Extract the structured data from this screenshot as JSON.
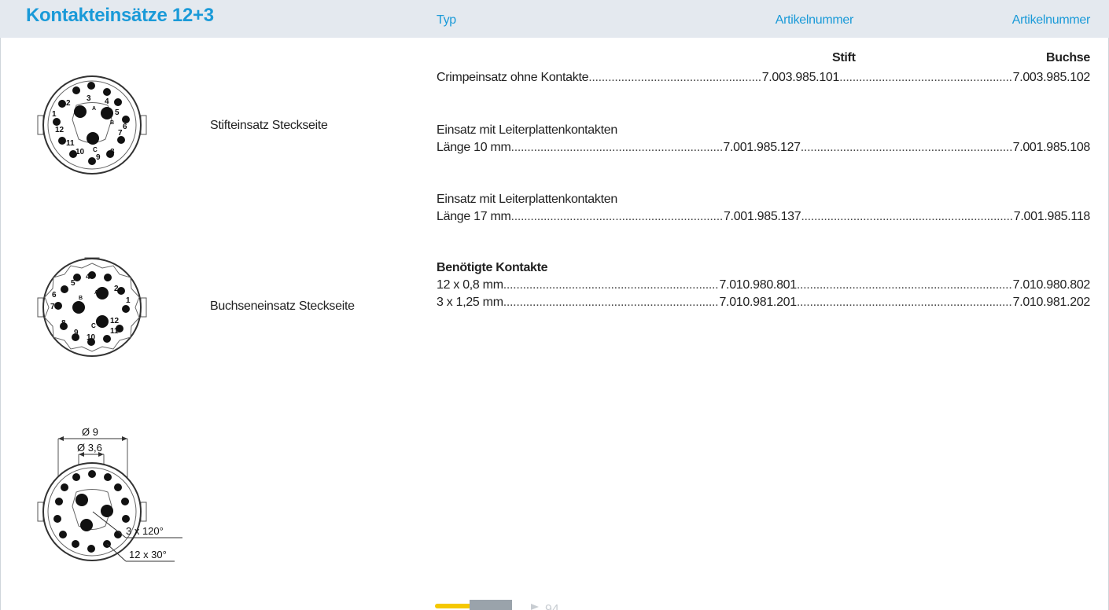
{
  "header": {
    "title": "Kontakteinsätze 12+3",
    "typ": "Typ",
    "artikel_1": "Artikelnummer",
    "artikel_2": "Artikelnummer"
  },
  "subheaders": {
    "stift": "Stift",
    "buchse": "Buchse"
  },
  "diagram_labels": {
    "stifteinsatz": "Stifteinsatz Steckseite",
    "buchseneinsatz": "Buchseneinsatz Steckseite"
  },
  "stift_pins": [
    "1",
    "2",
    "3",
    "4",
    "5",
    "6",
    "7",
    "8",
    "9",
    "10",
    "11",
    "12",
    "A",
    "B",
    "C"
  ],
  "buchse_pins": [
    "1",
    "2",
    "3",
    "4",
    "5",
    "6",
    "7",
    "8",
    "9",
    "10",
    "11",
    "12",
    "A",
    "B",
    "C"
  ],
  "dimensions": {
    "outer": "Ø 9",
    "inner": "Ø 3,6",
    "angle_large": "3 x 120°",
    "angle_small": "12 x 30°"
  },
  "rows": [
    {
      "lines": [
        {
          "name": "Crimpeinsatz ohne Kontakte ",
          "stift": "7.003.985.101",
          "buchse": "7.003.985.102"
        }
      ]
    },
    {
      "heading": "Einsatz mit Leiterplattenkontakten",
      "lines": [
        {
          "name": "Länge 10 mm ",
          "stift": "7.001.985.127",
          "buchse": "7.001.985.108"
        }
      ]
    },
    {
      "heading": "Einsatz mit Leiterplattenkontakten",
      "lines": [
        {
          "name": "Länge 17 mm ",
          "stift": "7.001.985.137",
          "buchse": "7.001.985.118"
        }
      ]
    },
    {
      "heading": "Benötigte Kontakte",
      "lines": [
        {
          "name": "12 x 0,8 mm",
          "stift": "7.010.980.801",
          "buchse": "7.010.980.802"
        },
        {
          "name": "3 x 1,25 mm",
          "stift": "7.010.981.201",
          "buchse": "7.010.981.202"
        }
      ]
    }
  ],
  "footer_ref": "94",
  "colors": {
    "accent": "#1a9ad8",
    "header_bg": "#e4e9ef",
    "pin_yellow": "#f5c800"
  }
}
